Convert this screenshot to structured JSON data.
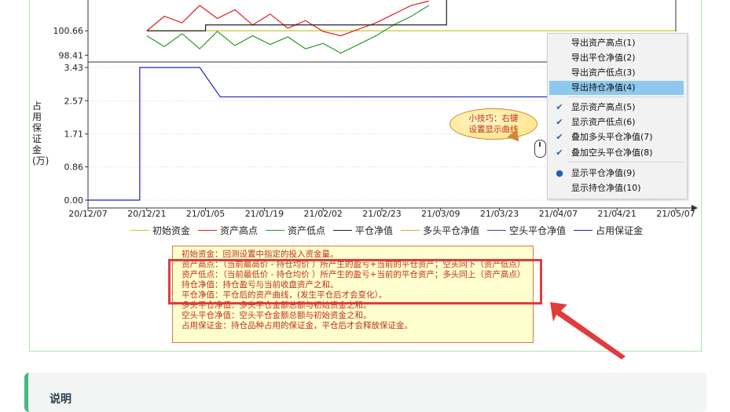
{
  "chart_data": {
    "type": "line",
    "x_ticks": [
      "20/12/07",
      "20/12/21",
      "21/01/05",
      "21/01/19",
      "21/02/02",
      "21/02/23",
      "21/03/09",
      "21/03/23",
      "21/04/07",
      "21/04/21",
      "21/05/07"
    ],
    "upper_panel": {
      "y_ticks": [
        "100.66",
        "98.41"
      ],
      "series": [
        {
          "name": "初始资金",
          "color": "#c8c832",
          "points": [
            [
              1,
              100.66
            ],
            [
              10,
              100.66
            ]
          ]
        },
        {
          "name": "资产高点",
          "color": "#e02020",
          "points": [
            [
              1,
              100.66
            ],
            [
              1.3,
              102.0
            ],
            [
              1.6,
              101.4
            ],
            [
              1.9,
              103.0
            ],
            [
              2.2,
              101.8
            ],
            [
              2.5,
              102.6
            ],
            [
              2.8,
              101.2
            ],
            [
              3.1,
              102.2
            ],
            [
              3.4,
              100.9
            ],
            [
              3.7,
              101.6
            ],
            [
              4.0,
              100.6
            ],
            [
              4.3,
              100.2
            ],
            [
              4.6,
              100.8
            ],
            [
              4.9,
              101.4
            ],
            [
              5.2,
              102.2
            ],
            [
              5.5,
              103.0
            ],
            [
              5.8,
              103.4
            ]
          ]
        },
        {
          "name": "资产低点",
          "color": "#2a9a2a",
          "points": [
            [
              1,
              100.2
            ],
            [
              1.3,
              99.2
            ],
            [
              1.6,
              100.4
            ],
            [
              1.9,
              99.0
            ],
            [
              2.2,
              100.6
            ],
            [
              2.5,
              99.3
            ],
            [
              2.8,
              100.2
            ],
            [
              3.1,
              99.4
            ],
            [
              3.4,
              100.1
            ],
            [
              3.7,
              99.0
            ],
            [
              4.0,
              99.5
            ],
            [
              4.3,
              98.6
            ],
            [
              4.6,
              99.4
            ],
            [
              4.9,
              100.2
            ],
            [
              5.2,
              101.2
            ],
            [
              5.5,
              102.0
            ],
            [
              5.8,
              103.0
            ]
          ]
        },
        {
          "name": "平仓净值",
          "color": "#222222",
          "points": [
            [
              1,
              100.66
            ],
            [
              2,
              100.66
            ],
            [
              2,
              101.2
            ],
            [
              6.1,
              101.2
            ],
            [
              6.1,
              103.5
            ]
          ]
        }
      ]
    },
    "lower_panel": {
      "y_ticks": [
        "3.43",
        "2.57",
        "1.71",
        "0.86",
        "0.00"
      ],
      "y_label": "占用保证金(万)",
      "series": [
        {
          "name": "占用保证金",
          "color": "#2020c0",
          "points": [
            [
              0,
              0.0
            ],
            [
              0.88,
              0.0
            ],
            [
              0.88,
              3.43
            ],
            [
              1.9,
              3.43
            ],
            [
              2.25,
              2.67
            ],
            [
              10,
              2.67
            ]
          ]
        }
      ]
    },
    "legend": [
      "初始资金",
      "资产高点",
      "资产低点",
      "平仓净值",
      "多头平仓净值",
      "空头平仓净值",
      "占用保证金"
    ],
    "legend_colors": [
      "#c8c832",
      "#e02020",
      "#2a9a2a",
      "#222222",
      "#f0a020",
      "#4040d0",
      "#2020c0"
    ]
  },
  "context_menu": {
    "items": [
      {
        "label": "导出资产高点(1)",
        "check": "",
        "selected": false
      },
      {
        "label": "导出平仓净值(2)",
        "check": "",
        "selected": false
      },
      {
        "label": "导出资产低点(3)",
        "check": "",
        "selected": false
      },
      {
        "label": "导出持仓净值(4)",
        "check": "",
        "selected": true
      },
      {
        "label": "显示资产高点(5)",
        "check": "✔",
        "selected": false
      },
      {
        "label": "显示资产低点(6)",
        "check": "✔",
        "selected": false
      },
      {
        "label": "叠加多头平仓净值(7)",
        "check": "✔",
        "selected": false
      },
      {
        "label": "叠加空头平仓净值(8)",
        "check": "✔",
        "selected": false
      },
      {
        "label": "显示平仓净值(9)",
        "check": "●",
        "selected": false
      },
      {
        "label": "显示持仓净值(10)",
        "check": "",
        "selected": false
      }
    ]
  },
  "tip": {
    "line1": "小技巧：右键",
    "line2": "设置显示曲线"
  },
  "notes": [
    "初始资金：回测设置中指定的投入资金量。",
    "资产高点：（当前最高价 - 持仓均价 ）所产生的盈亏+当前的平仓资产；空头同下（资产低点）",
    "资产低点：（当前最低价 - 持仓均价 ）所产生的盈亏+当前的平仓资产；多头同上（资产高点）",
    "持仓净值：持仓盈亏与当前收盘资产之和。",
    "平仓净值：平仓后的资产曲线，(发生平仓后才会变化）。",
    "多头平仓净值：多头平仓金额总额与初始资金之和。",
    "空头平仓净值：空头平仓金额总额与初始资金之和。",
    "占用保证金：持仓品种占用的保证金，平仓后才会释放保证金。"
  ],
  "info_box": {
    "title": "说明"
  },
  "colors": {
    "accent": "#42b983",
    "highlight_box": "#e23b3b",
    "menu_selected": "#8ec8ef"
  }
}
